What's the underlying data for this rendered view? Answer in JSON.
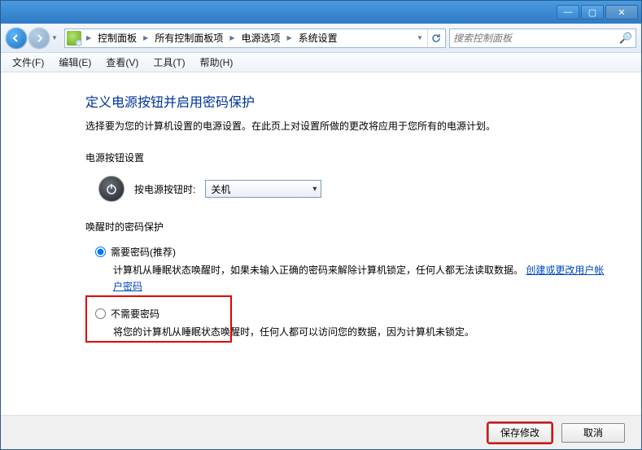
{
  "titlebar": {
    "min": "—",
    "max": "▢",
    "close": "✕"
  },
  "breadcrumbs": [
    "控制面板",
    "所有控制面板项",
    "电源选项",
    "系统设置"
  ],
  "search": {
    "placeholder": "搜索控制面板"
  },
  "menus": [
    {
      "label": "文件(F)"
    },
    {
      "label": "编辑(E)"
    },
    {
      "label": "查看(V)"
    },
    {
      "label": "工具(T)"
    },
    {
      "label": "帮助(H)"
    }
  ],
  "page": {
    "title": "定义电源按钮并启用密码保护",
    "desc": "选择要为您的计算机设置的电源设置。在此页上对设置所做的更改将应用于您所有的电源计划。",
    "power_button_section": "电源按钮设置",
    "power_button_label": "按电源按钮时:",
    "power_button_value": "关机",
    "password_section": "唤醒时的密码保护",
    "opt_require": {
      "label": "需要密码(推荐)",
      "desc_a": "计算机从睡眠状态唤醒时，如果未输入正确的密码来解除计算机锁定，任何人都无法读取数据。",
      "link": "创建或更改用户帐户密码"
    },
    "opt_norequire": {
      "label": "不需要密码",
      "desc": "将您的计算机从睡眠状态唤醒时，任何人都可以访问您的数据，因为计算机未锁定。"
    }
  },
  "footer": {
    "save": "保存修改",
    "cancel": "取消"
  }
}
